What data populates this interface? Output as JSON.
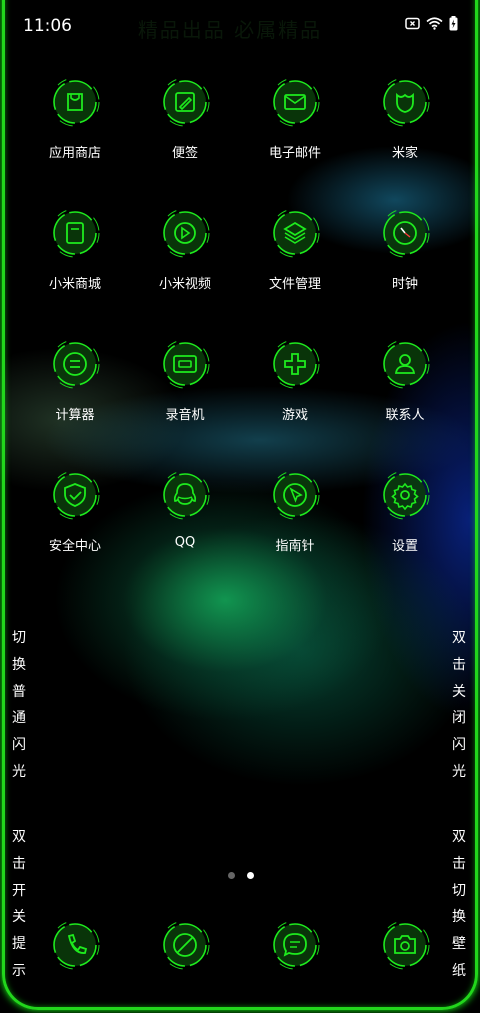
{
  "status_bar": {
    "time": "11:06"
  },
  "watermark": "精品出品 必属精品",
  "apps": [
    {
      "label": "应用商店",
      "icon": "bag-icon"
    },
    {
      "label": "便签",
      "icon": "note-edit-icon"
    },
    {
      "label": "电子邮件",
      "icon": "mail-icon"
    },
    {
      "label": "米家",
      "icon": "mijia-icon"
    },
    {
      "label": "小米商城",
      "icon": "store-icon"
    },
    {
      "label": "小米视频",
      "icon": "video-play-icon"
    },
    {
      "label": "文件管理",
      "icon": "layers-icon"
    },
    {
      "label": "时钟",
      "icon": "clock-icon"
    },
    {
      "label": "计算器",
      "icon": "calculator-icon"
    },
    {
      "label": "录音机",
      "icon": "recorder-icon"
    },
    {
      "label": "游戏",
      "icon": "gamepad-icon"
    },
    {
      "label": "联系人",
      "icon": "contact-icon"
    },
    {
      "label": "安全中心",
      "icon": "shield-icon"
    },
    {
      "label": "QQ",
      "icon": "qq-icon"
    },
    {
      "label": "指南针",
      "icon": "compass-icon"
    },
    {
      "label": "设置",
      "icon": "gear-icon"
    }
  ],
  "side_hints": {
    "left_top": [
      "切",
      "换",
      "普",
      "通",
      "闪",
      "光"
    ],
    "left_bottom": [
      "双",
      "击",
      "开",
      "关",
      "提",
      "示"
    ],
    "right_top": [
      "双",
      "击",
      "关",
      "闭",
      "闪",
      "光"
    ],
    "right_bottom": [
      "双",
      "击",
      "切",
      "换",
      "壁",
      "纸"
    ]
  },
  "page_indicator": {
    "total": 2,
    "active": 2
  },
  "dock": [
    {
      "icon": "phone-icon"
    },
    {
      "icon": "browser-icon"
    },
    {
      "icon": "message-icon"
    },
    {
      "icon": "camera-icon"
    }
  ],
  "colors": {
    "neon_green": "#1eea1e",
    "dark_green": "#0a3d0a",
    "edge": "#22d61c"
  }
}
